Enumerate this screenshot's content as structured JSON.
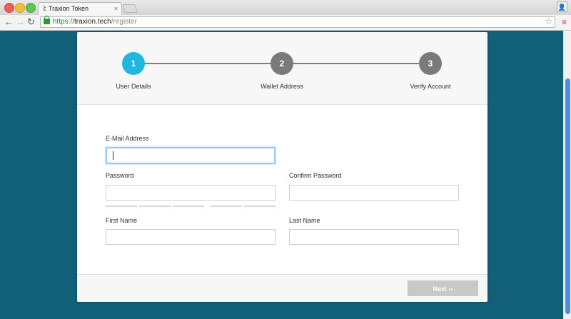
{
  "browser": {
    "tab_title": "Traxion Token",
    "tab_close": "×",
    "url_scheme": "https://",
    "url_host": "traxion.tech",
    "url_path": "/register"
  },
  "wizard": {
    "steps": [
      {
        "number": "1",
        "label": "User Details",
        "active": true
      },
      {
        "number": "2",
        "label": "Wallet Address",
        "active": false
      },
      {
        "number": "3",
        "label": "Verify Account",
        "active": false
      }
    ]
  },
  "form": {
    "email_label": "E-Mail Address",
    "email_value": "",
    "password_label": "Password",
    "password_value": "",
    "confirm_password_label": "Confirm Password",
    "confirm_password_value": "",
    "first_name_label": "First Name",
    "first_name_value": "",
    "last_name_label": "Last Name",
    "last_name_value": ""
  },
  "footer": {
    "next_label": "Next ››"
  },
  "colors": {
    "page_background": "#125f78",
    "active_step": "#22b5e0",
    "inactive_step": "#7a7a7a",
    "next_button_disabled": "#c8c8c8"
  },
  "icons": [
    "tab-favicon-icon",
    "back-arrow-icon",
    "forward-arrow-icon",
    "reload-icon",
    "lock-icon",
    "star-icon",
    "menu-icon",
    "profile-icon"
  ]
}
